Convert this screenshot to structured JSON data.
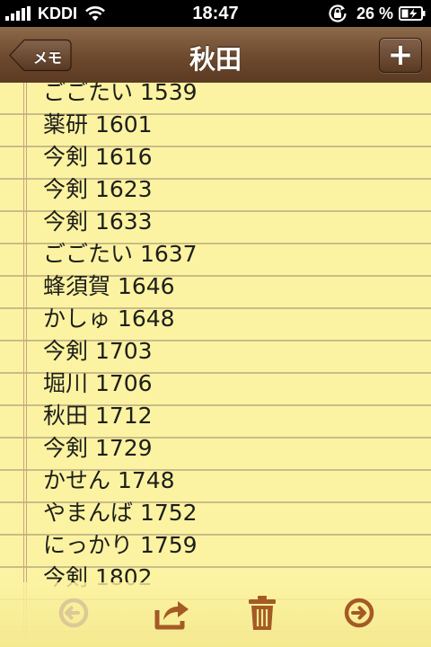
{
  "status_bar": {
    "carrier": "KDDI",
    "time": "18:47",
    "battery_percent": "26 %"
  },
  "nav": {
    "back_label": "メモ",
    "title": "秋田",
    "add_label": "+"
  },
  "note": {
    "lines": [
      "ごごたい 1539",
      "薬研 1601",
      "今剣 1616",
      "今剣 1623",
      "今剣 1633",
      "ごごたい 1637",
      "蜂須賀 1646",
      "かしゅ 1648",
      "今剣 1703",
      "堀川 1706",
      "秋田 1712",
      "今剣 1729",
      "かせん 1748",
      "やまんば 1752",
      "にっかり 1759",
      "今剣 1802"
    ]
  },
  "toolbar": {
    "items": [
      {
        "icon": "previous-arrow-icon",
        "enabled": false
      },
      {
        "icon": "share-icon",
        "enabled": true
      },
      {
        "icon": "trash-icon",
        "enabled": true
      },
      {
        "icon": "next-arrow-icon",
        "enabled": true
      }
    ]
  },
  "colors": {
    "paper": "#fcf3a2",
    "rule_line": "#c9bc87",
    "nav_brown": "#6f4b2f",
    "toolbar_icon": "#a45a25",
    "toolbar_icon_disabled": "#dcc997"
  }
}
